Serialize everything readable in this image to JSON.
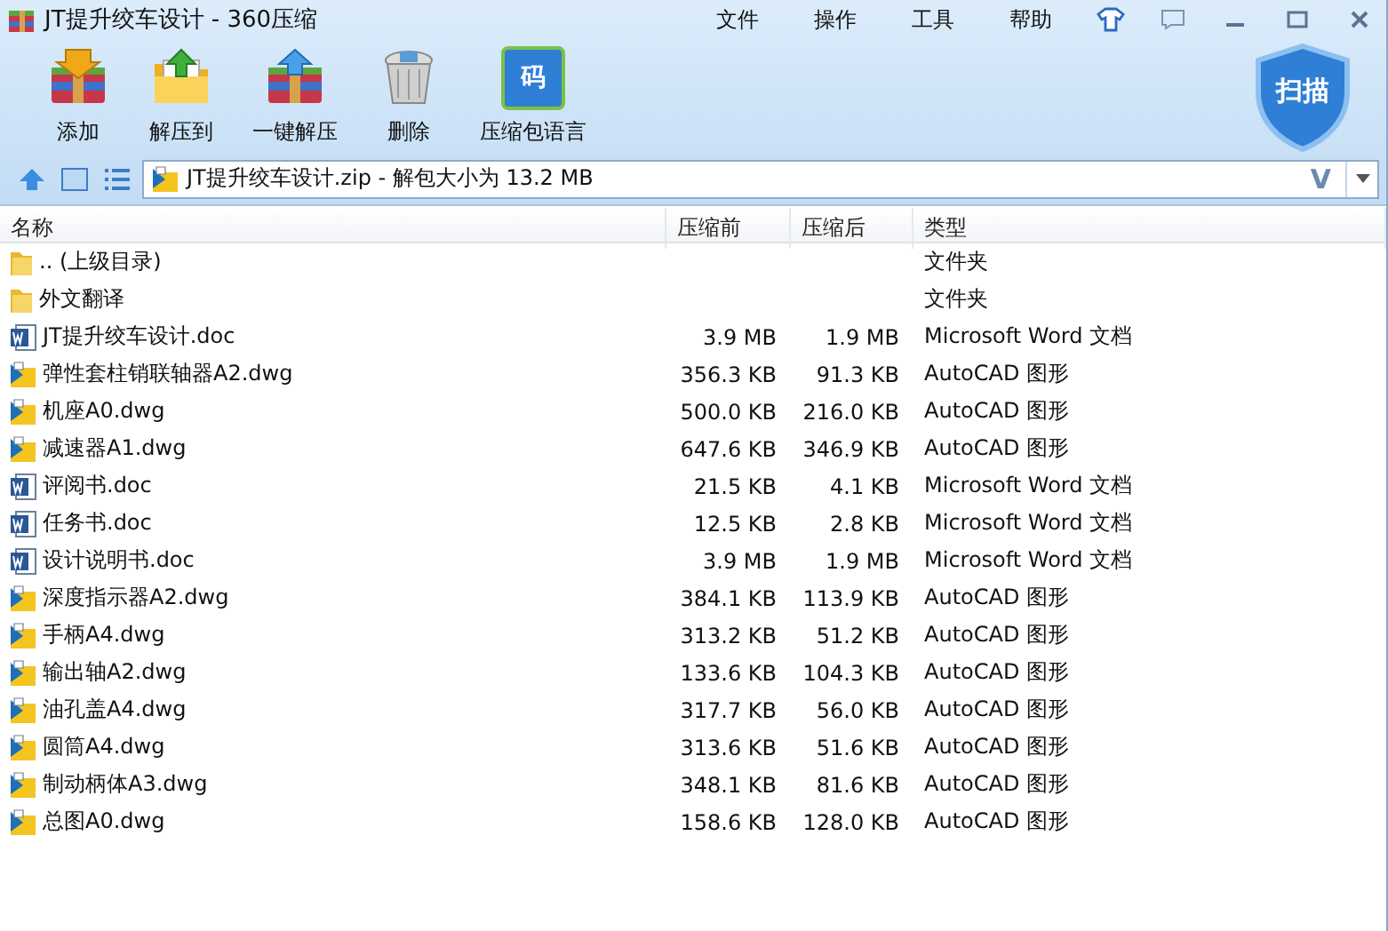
{
  "window": {
    "title": "JT提升绞车设计 - 360压缩"
  },
  "menu": [
    "文件",
    "操作",
    "工具",
    "帮助"
  ],
  "toolbar": [
    {
      "label": "添加",
      "kind": "add"
    },
    {
      "label": "解压到",
      "kind": "extract"
    },
    {
      "label": "一键解压",
      "kind": "oneclick"
    },
    {
      "label": "删除",
      "kind": "delete"
    },
    {
      "label": "压缩包语言",
      "kind": "language",
      "icon_text": "码"
    }
  ],
  "scan_button": "扫描",
  "address": {
    "value": "JT提升绞车设计.zip - 解包大小为 13.2 MB",
    "dropdown_letter": "V"
  },
  "table": {
    "columns": [
      "名称",
      "压缩前",
      "压缩后",
      "类型"
    ],
    "rows": [
      {
        "kind": "folder",
        "name": ".. (上级目录)",
        "before": "",
        "after": "",
        "type": "文件夹"
      },
      {
        "kind": "folder",
        "name": "外文翻译",
        "before": "",
        "after": "",
        "type": "文件夹"
      },
      {
        "kind": "doc",
        "name": "JT提升绞车设计.doc",
        "before": "3.9 MB",
        "after": "1.9 MB",
        "type": "Microsoft Word 文档"
      },
      {
        "kind": "dwg",
        "name": "弹性套柱销联轴器A2.dwg",
        "before": "356.3 KB",
        "after": "91.3 KB",
        "type": "AutoCAD 图形"
      },
      {
        "kind": "dwg",
        "name": "机座A0.dwg",
        "before": "500.0 KB",
        "after": "216.0 KB",
        "type": "AutoCAD 图形"
      },
      {
        "kind": "dwg",
        "name": "减速器A1.dwg",
        "before": "647.6 KB",
        "after": "346.9 KB",
        "type": "AutoCAD 图形"
      },
      {
        "kind": "doc",
        "name": "评阅书.doc",
        "before": "21.5 KB",
        "after": "4.1 KB",
        "type": "Microsoft Word 文档"
      },
      {
        "kind": "doc",
        "name": "任务书.doc",
        "before": "12.5 KB",
        "after": "2.8 KB",
        "type": "Microsoft Word 文档"
      },
      {
        "kind": "doc",
        "name": "设计说明书.doc",
        "before": "3.9 MB",
        "after": "1.9 MB",
        "type": "Microsoft Word 文档"
      },
      {
        "kind": "dwg",
        "name": "深度指示器A2.dwg",
        "before": "384.1 KB",
        "after": "113.9 KB",
        "type": "AutoCAD 图形"
      },
      {
        "kind": "dwg",
        "name": "手柄A4.dwg",
        "before": "313.2 KB",
        "after": "51.2 KB",
        "type": "AutoCAD 图形"
      },
      {
        "kind": "dwg",
        "name": "输出轴A2.dwg",
        "before": "133.6 KB",
        "after": "104.3 KB",
        "type": "AutoCAD 图形"
      },
      {
        "kind": "dwg",
        "name": "油孔盖A4.dwg",
        "before": "317.7 KB",
        "after": "56.0 KB",
        "type": "AutoCAD 图形"
      },
      {
        "kind": "dwg",
        "name": "圆筒A4.dwg",
        "before": "313.6 KB",
        "after": "51.6 KB",
        "type": "AutoCAD 图形"
      },
      {
        "kind": "dwg",
        "name": "制动柄体A3.dwg",
        "before": "348.1 KB",
        "after": "81.6 KB",
        "type": "AutoCAD 图形"
      },
      {
        "kind": "dwg",
        "name": "总图A0.dwg",
        "before": "158.6 KB",
        "after": "128.0 KB",
        "type": "AutoCAD 图形"
      }
    ]
  }
}
